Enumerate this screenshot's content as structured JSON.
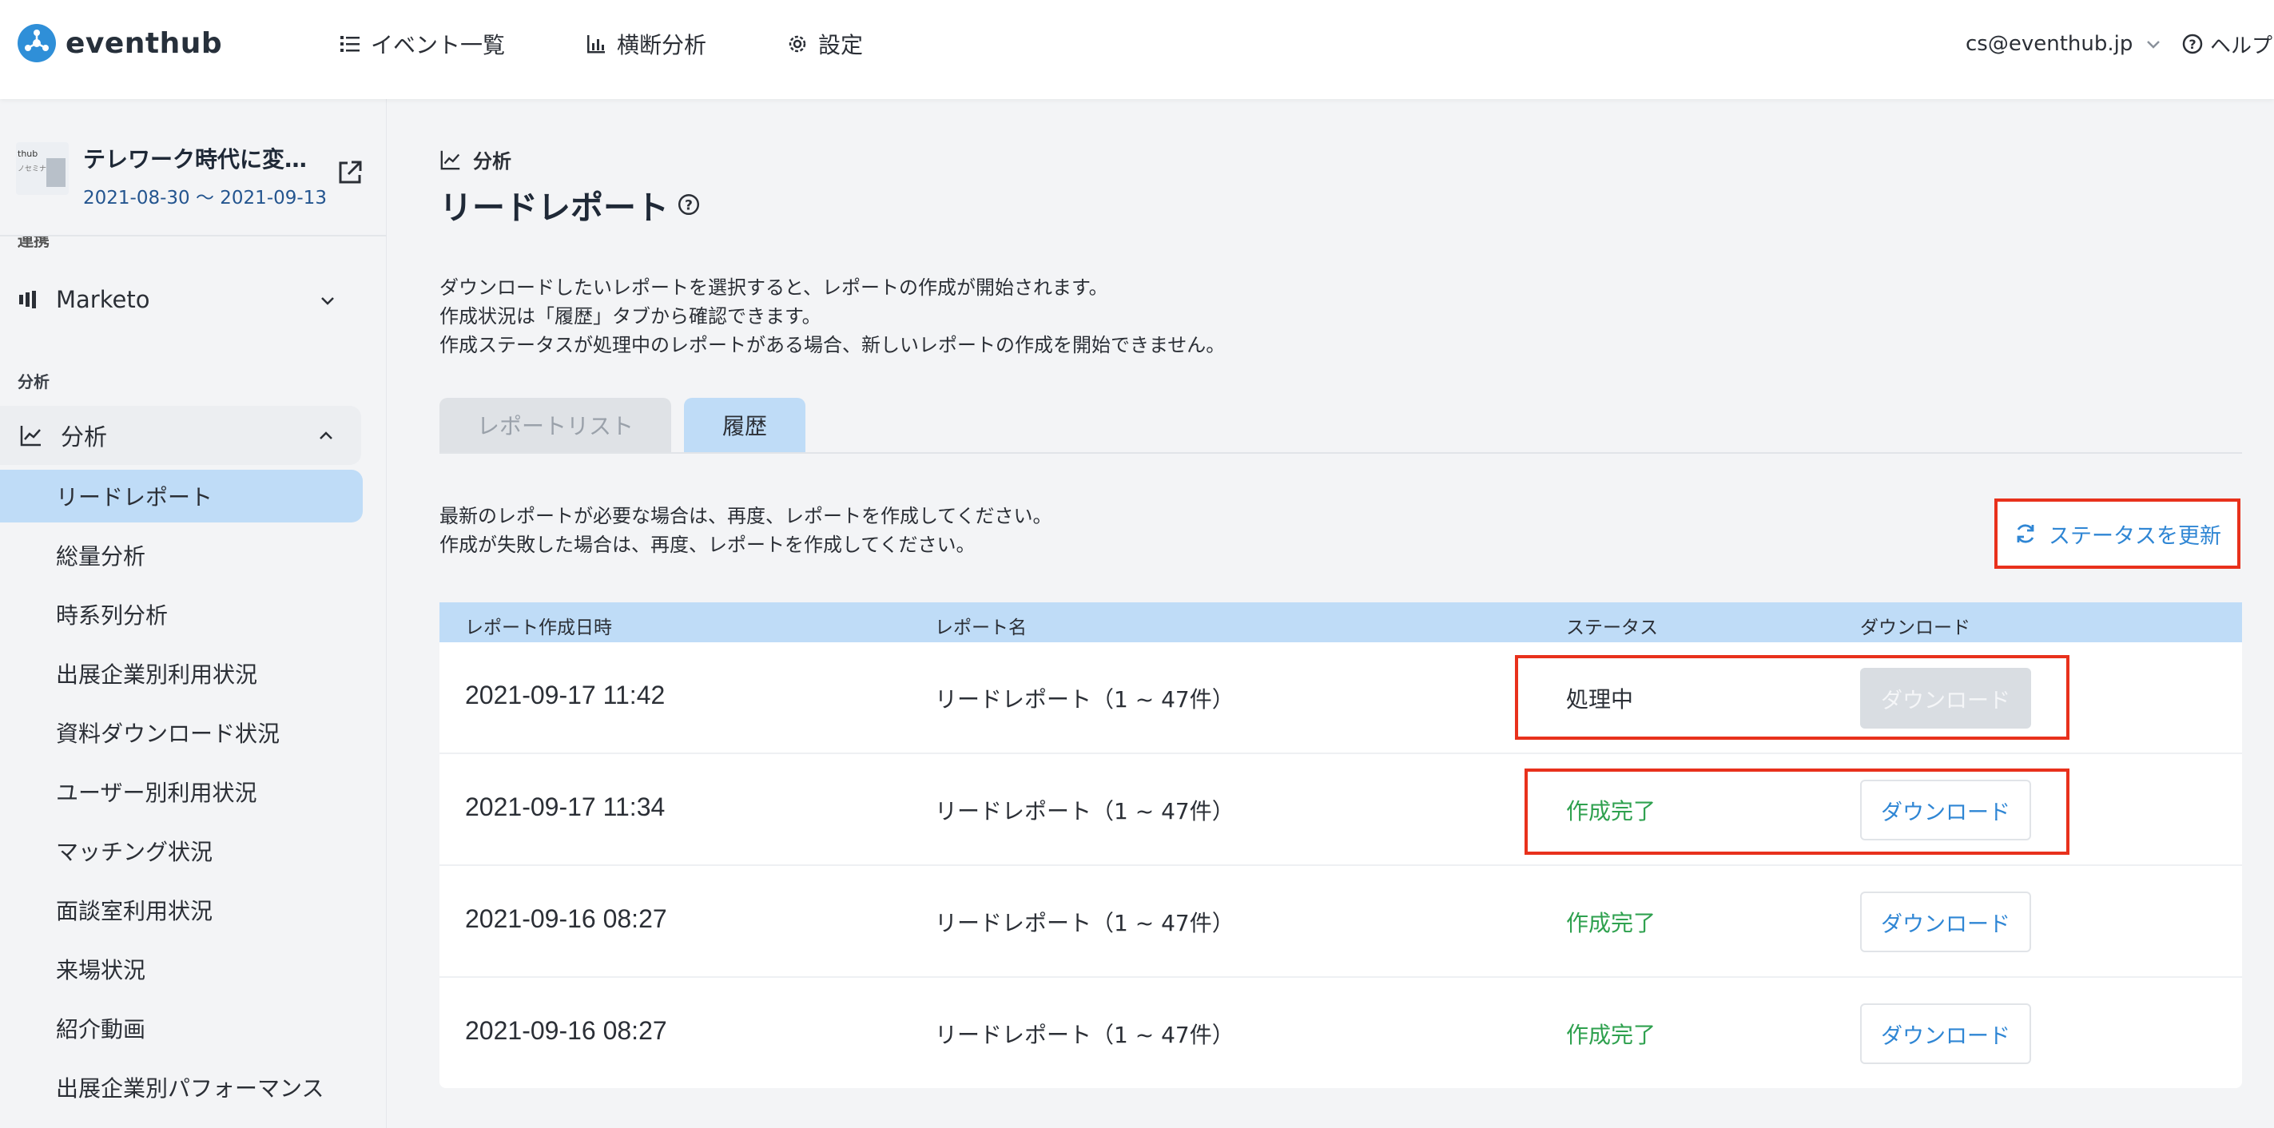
{
  "header": {
    "logo_text": "eventhub",
    "nav": [
      {
        "label": "イベント一覧",
        "icon": "list-icon"
      },
      {
        "label": "横断分析",
        "icon": "bar-chart-icon"
      },
      {
        "label": "設定",
        "icon": "gear-icon"
      }
    ],
    "user_email": "cs@eventhub.jp",
    "help_label": "ヘルプ"
  },
  "sidebar": {
    "event": {
      "thumb_text_1": "thub",
      "thumb_text_2": "ノセミナー",
      "title": "テレワーク時代に変わるセミナー",
      "dates": "2021-08-30 〜 2021-09-13"
    },
    "cut_section_label": "連携",
    "marketo_label": "Marketo",
    "section_label": "分析",
    "group_label": "分析",
    "items": [
      {
        "label": "リードレポート",
        "active": true
      },
      {
        "label": "総量分析"
      },
      {
        "label": "時系列分析"
      },
      {
        "label": "出展企業別利用状況"
      },
      {
        "label": "資料ダウンロード状況"
      },
      {
        "label": "ユーザー別利用状況"
      },
      {
        "label": "マッチング状況"
      },
      {
        "label": "面談室利用状況"
      },
      {
        "label": "来場状況"
      },
      {
        "label": "紹介動画"
      },
      {
        "label": "出展企業別パフォーマンス"
      }
    ]
  },
  "main": {
    "breadcrumb": "分析",
    "title": "リードレポート",
    "description": [
      "ダウンロードしたいレポートを選択すると、レポートの作成が開始されます。",
      "作成状況は「履歴」タブから確認できます。",
      "作成ステータスが処理中のレポートがある場合、新しいレポートの作成を開始できません。"
    ],
    "tabs": [
      {
        "label": "レポートリスト",
        "active": false
      },
      {
        "label": "履歴",
        "active": true
      }
    ],
    "notice": [
      "最新のレポートが必要な場合は、再度、レポートを作成してください。",
      "作成が失敗した場合は、再度、レポートを作成してください。"
    ],
    "refresh_label": "ステータスを更新",
    "table": {
      "headers": [
        "レポート作成日時",
        "レポート名",
        "ステータス",
        "ダウンロード"
      ],
      "rows": [
        {
          "date": "2021-09-17 11:42",
          "name": "リードレポート（1 ~ 47件）",
          "status": "処理中",
          "download": "ダウンロード",
          "enabled": false
        },
        {
          "date": "2021-09-17 11:34",
          "name": "リードレポート（1 ~ 47件）",
          "status": "作成完了",
          "download": "ダウンロード",
          "enabled": true
        },
        {
          "date": "2021-09-16 08:27",
          "name": "リードレポート（1 ~ 47件）",
          "status": "作成完了",
          "download": "ダウンロード",
          "enabled": true
        },
        {
          "date": "2021-09-16 08:27",
          "name": "リードレポート（1 ~ 47件）",
          "status": "作成完了",
          "download": "ダウンロード",
          "enabled": true
        }
      ]
    }
  },
  "colors": {
    "accent": "#2f86d4",
    "highlight": "#e8311c",
    "success": "#2fa14f",
    "tab_active": "#bfdcf7"
  }
}
